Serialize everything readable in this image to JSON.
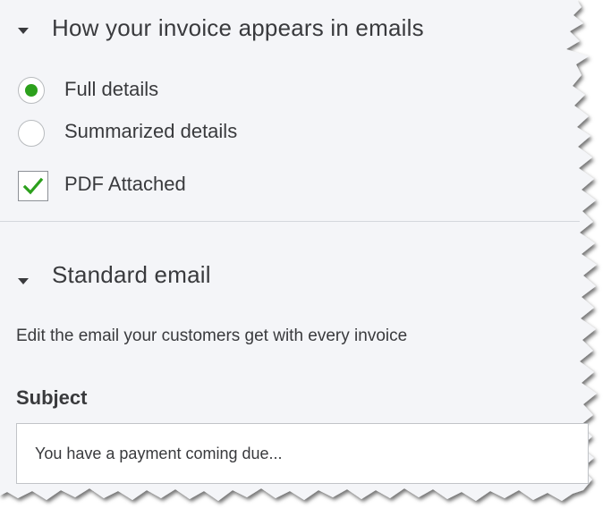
{
  "delivery": {
    "title": "How your invoice appears in emails",
    "options": [
      {
        "label": "Full details",
        "selected": true
      },
      {
        "label": "Summarized details",
        "selected": false
      }
    ],
    "pdf": {
      "label": "PDF Attached",
      "checked": true
    }
  },
  "standard_email": {
    "title": "Standard email",
    "description": "Edit the email your customers get with every invoice",
    "subject_label": "Subject",
    "subject_value": "You have a payment coming due..."
  },
  "colors": {
    "accent": "#2ca01c",
    "panel": "#f4f5f8",
    "text": "#393a3d"
  }
}
